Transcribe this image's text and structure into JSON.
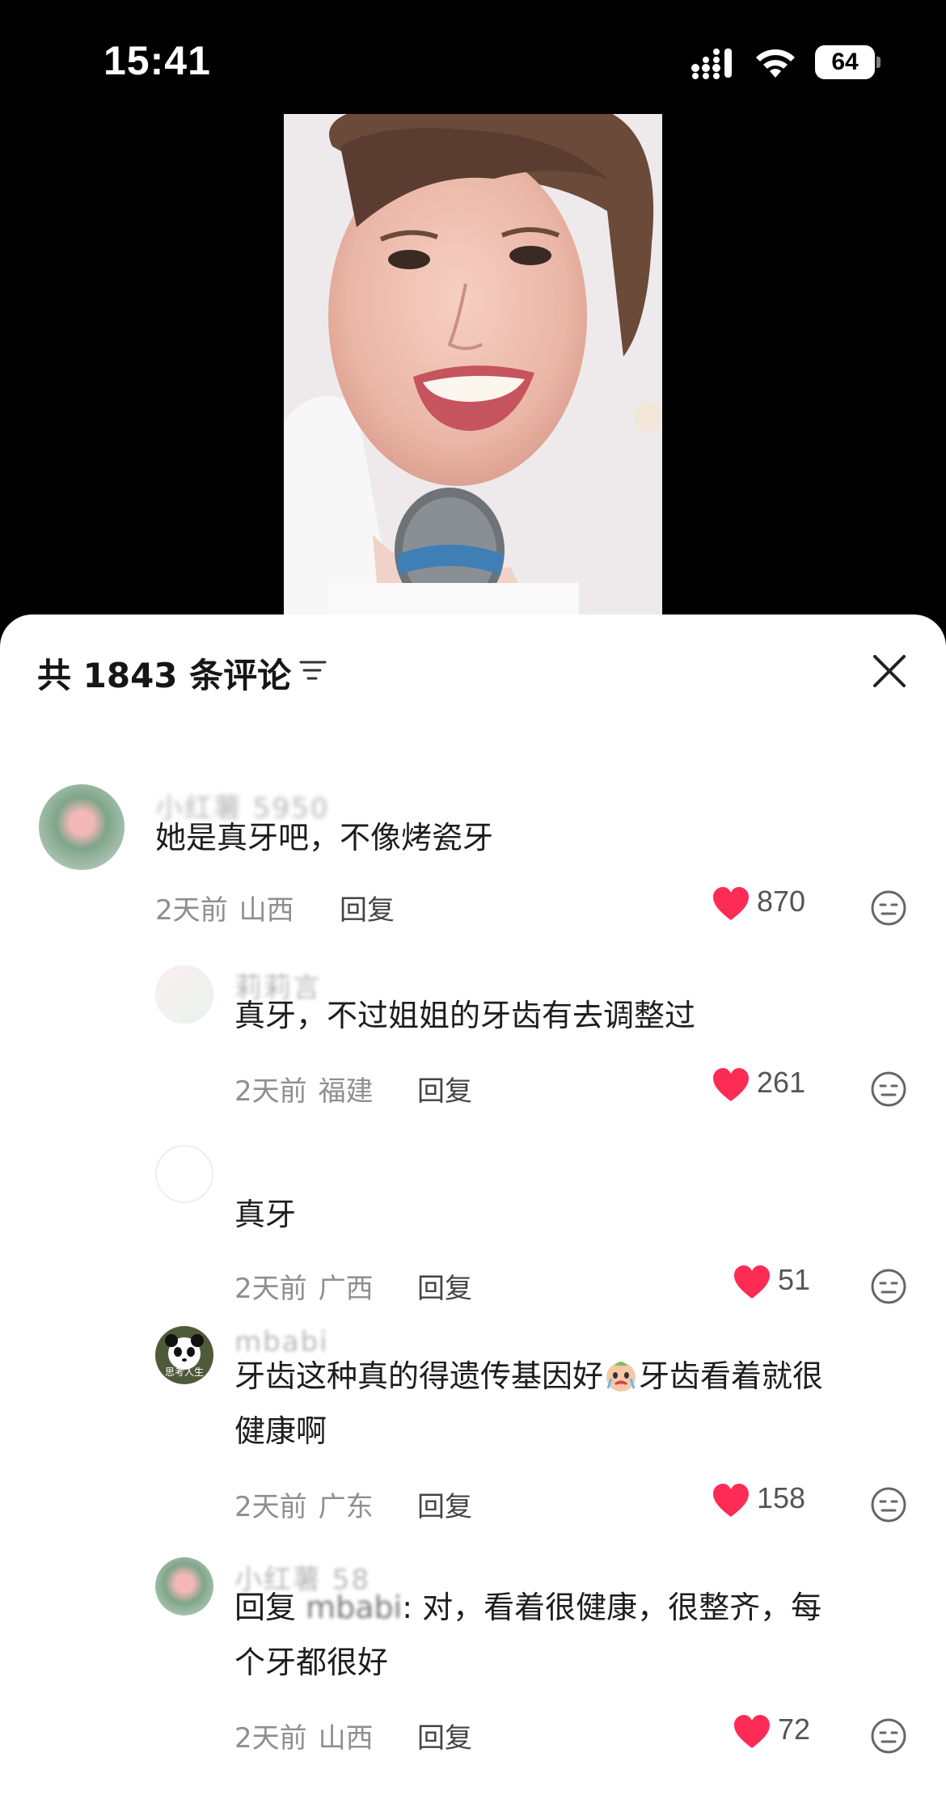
{
  "status_bar": {
    "time": "15:41",
    "battery": "64"
  },
  "comments_header": {
    "title": "共 1843 条评论"
  },
  "comments": [
    {
      "username": "小红薯 5950",
      "text": "她是真牙吧，不像烤瓷牙",
      "time": "2天前",
      "location": "山西",
      "reply_label": "回复",
      "likes": "870"
    },
    {
      "username": "莉莉言",
      "text": "真牙，不过姐姐的牙齿有去调整过",
      "time": "2天前",
      "location": "福建",
      "reply_label": "回复",
      "likes": "261"
    },
    {
      "username": "",
      "text": "真牙",
      "time": "2天前",
      "location": "广西",
      "reply_label": "回复",
      "likes": "51"
    },
    {
      "username": "mbabi",
      "text_line1": "牙齿这种真的得遗传基因好",
      "text_line1_b": "牙齿看着就很",
      "text_line2": "健康啊",
      "time": "2天前",
      "location": "广东",
      "reply_label": "回复",
      "likes": "158",
      "avatar_caption": "思考人生"
    },
    {
      "username": "小红薯 58",
      "reply_prefix": "回复",
      "reply_target": "mbabi",
      "text_line1": ": 对，看着很健康，很整齐，每",
      "text_line2": "个牙都很好",
      "time": "2天前",
      "location": "山西",
      "reply_label": "回复",
      "likes": "72"
    }
  ],
  "colors": {
    "like_red": "#fe2c55",
    "meta_gray": "#8e8e93"
  }
}
